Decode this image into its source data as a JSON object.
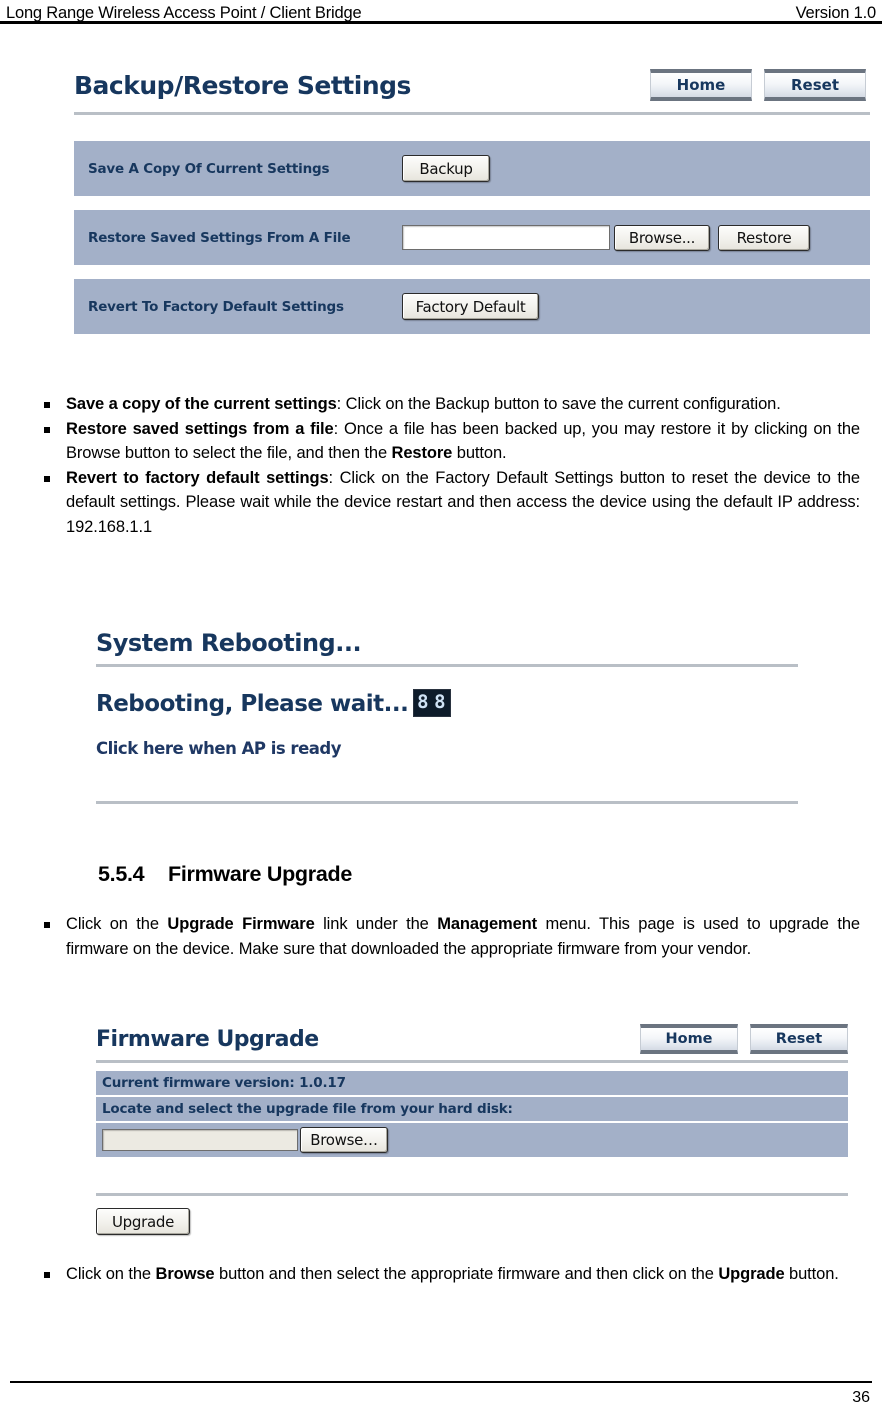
{
  "page": {
    "header_title": "Long Range Wireless Access Point / Client Bridge",
    "header_version": "Version 1.0",
    "footer_page_number": "36"
  },
  "backup_panel": {
    "title": "Backup/Restore Settings",
    "nav": {
      "home": "Home",
      "reset": "Reset"
    },
    "rows": [
      {
        "label": "Save A Copy Of Current Settings",
        "button": "Backup"
      },
      {
        "label": "Restore Saved Settings From A File",
        "input_value": "",
        "browse": "Browse...",
        "button": "Restore"
      },
      {
        "label": "Revert To Factory Default Settings",
        "button": "Factory Default"
      }
    ]
  },
  "backup_bullets": [
    {
      "lead": "Save a copy of the current settings",
      "body": ": Click on the Backup button to save the current configuration."
    },
    {
      "lead": "Restore saved settings from a file",
      "body_1": ": Once a file has been backed up, you may restore it by clicking on the Browse button to select the file, and then the ",
      "emphasis": "Restore",
      "body_2": " button."
    },
    {
      "lead": "Revert to factory default settings",
      "body": ": Click on the Factory Default Settings button to reset the device to the default settings. Please wait while the device restart and then access the device using the default IP address: 192.168.1.1"
    }
  ],
  "reboot_panel": {
    "title": "System Rebooting...",
    "status_text": "Rebooting, Please wait...",
    "led_digit_1": "8",
    "led_digit_2": "8",
    "link_text": "Click here when AP is ready"
  },
  "firmware_section": {
    "number": "5.5.4",
    "title": "Firmware Upgrade",
    "bullet": {
      "t1": "Click on the ",
      "b1": "Upgrade Firmware",
      "t2": " link under the ",
      "b2": "Management",
      "t3": " menu. This page is used to upgrade the firmware on the device. Make sure that downloaded the appropriate firmware from your vendor."
    }
  },
  "firmware_panel": {
    "title": "Firmware Upgrade",
    "nav": {
      "home": "Home",
      "reset": "Reset"
    },
    "current_version_label": "Current firmware version: 1.0.17",
    "locate_label": "Locate and select the upgrade file from your hard disk:",
    "file_input_value": "",
    "browse_button": "Browse…",
    "upgrade_button": "Upgrade"
  },
  "closing_bullet": {
    "t1": "Click on the ",
    "b1": "Browse",
    "t2": " button and then select the appropriate firmware and then click on the ",
    "b2": "Upgrade",
    "t3": " button."
  },
  "colors": {
    "panel_row_bg": "#a3b0c8",
    "panel_title_text": "#17375e",
    "link_text": "#1f3864"
  }
}
